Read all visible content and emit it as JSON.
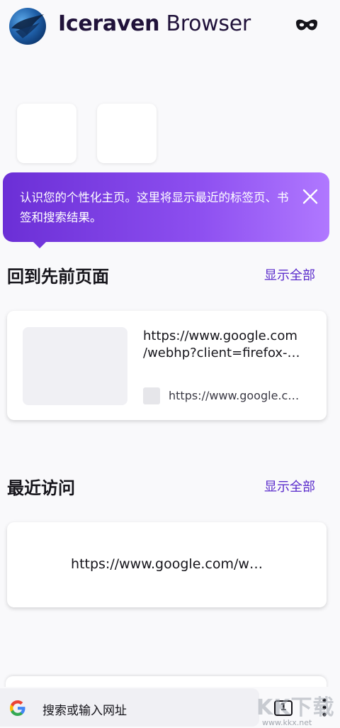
{
  "header": {
    "brand_bold": "Iceraven",
    "brand_light": " Browser",
    "logo_icon": "iceraven-logo-icon",
    "private_icon": "private-browsing-mask-icon"
  },
  "onboarding": {
    "message": "认识您的个性化主页。这里将显示最近的标签页、书签和搜索结果。",
    "close_icon": "close-icon"
  },
  "jump_back_in": {
    "title": "回到先前页面",
    "show_all": "显示全部",
    "card": {
      "title_line1": "https://www.google.com",
      "title_line2": "/webhp?client=firefox-…",
      "url": "https://www.google.c…"
    }
  },
  "recent_visits": {
    "title": "最近访问",
    "show_all": "显示全部",
    "card": {
      "title": "https://www.google.com/w…"
    }
  },
  "toolbar": {
    "search_engine_icon": "google-g-icon",
    "placeholder": "搜索或输入网址",
    "tab_count": "1",
    "menu_icon": "three-dot-menu-icon"
  },
  "watermark": {
    "big": "KK下载",
    "small": "www.kkx.net"
  },
  "colors": {
    "accent": "#592acb",
    "popup_start": "#6b2fd6",
    "popup_end": "#b078ff",
    "background": "#f9f9fb"
  }
}
